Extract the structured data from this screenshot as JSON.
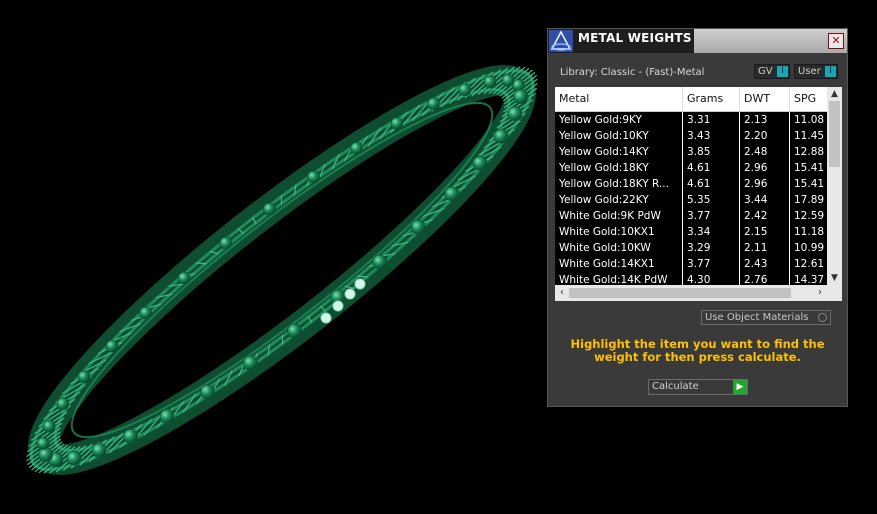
{
  "colors": {
    "metal_green": "#1c8d5a",
    "highlight": "#ffc000",
    "toggle_indicator": "#18a6b8",
    "go_green": "#1fa82f"
  },
  "panel": {
    "title": "METAL WEIGHTS",
    "close_label": "✕",
    "library_label": "Library: Classic - (Fast)-Metal",
    "gv_label": "GV",
    "user_label": "User",
    "toggle_indicator": "I",
    "table": {
      "columns": [
        "Metal",
        "Grams",
        "DWT",
        "SPG"
      ],
      "rows": [
        [
          "Yellow Gold:9KY",
          "3.31",
          "2.13",
          "11.08"
        ],
        [
          "Yellow Gold:10KY",
          "3.43",
          "2.20",
          "11.45"
        ],
        [
          "Yellow Gold:14KY",
          "3.85",
          "2.48",
          "12.88"
        ],
        [
          "Yellow Gold:18KY",
          "4.61",
          "2.96",
          "15.41"
        ],
        [
          "Yellow Gold:18KY R...",
          "4.61",
          "2.96",
          "15.41"
        ],
        [
          "Yellow Gold:22KY",
          "5.35",
          "3.44",
          "17.89"
        ],
        [
          "White Gold:9K PdW",
          "3.77",
          "2.42",
          "12.59"
        ],
        [
          "White Gold:10KX1",
          "3.34",
          "2.15",
          "11.18"
        ],
        [
          "White Gold:10KW",
          "3.29",
          "2.11",
          "10.99"
        ],
        [
          "White Gold:14KX1",
          "3.77",
          "2.43",
          "12.61"
        ],
        [
          "White Gold:14K PdW",
          "4.30",
          "2.76",
          "14.37"
        ]
      ]
    },
    "use_materials_label": "Use Object Materials",
    "instructions": "Highlight the item you want to find the weight for then press calculate.",
    "calculate_label": "Calculate"
  }
}
